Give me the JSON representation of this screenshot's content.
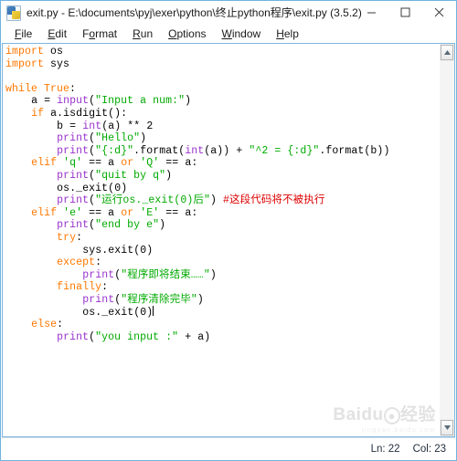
{
  "window": {
    "title": "exit.py - E:\\documents\\pyj\\exer\\python\\终止python程序\\exit.py (3.5.2)",
    "icon": "python-file-icon",
    "minimize_label": "─",
    "maximize_label": "☐",
    "close_label": "✕"
  },
  "menubar": {
    "items": [
      {
        "label": "File",
        "accel": "F",
        "rest": "ile"
      },
      {
        "label": "Edit",
        "accel": "E",
        "rest": "dit"
      },
      {
        "label": "Format",
        "accel": "o",
        "pre": "F",
        "rest": "rmat"
      },
      {
        "label": "Run",
        "accel": "R",
        "rest": "un"
      },
      {
        "label": "Options",
        "accel": "O",
        "rest": "ptions"
      },
      {
        "label": "Window",
        "accel": "W",
        "rest": "indow"
      },
      {
        "label": "Help",
        "accel": "H",
        "rest": "elp"
      }
    ]
  },
  "editor": {
    "language": "python",
    "cursor_line": 22,
    "cursor_col": 23,
    "lines": [
      "import os",
      "import sys",
      "",
      "while True:",
      "    a = input(\"Input a num:\")",
      "    if a.isdigit():",
      "        b = int(a) ** 2",
      "        print(\"Hello\")",
      "        print(\"{:d}\".format(int(a)) + \"^2 = {:d}\".format(b))",
      "    elif 'q' == a or 'Q' == a:",
      "        print(\"quit by q\")",
      "        os._exit(0)",
      "        print(\"运行os._exit(0)后\") #这段代码将不被执行",
      "    elif 'e' == a or 'E' == a:",
      "        print(\"end by e\")",
      "        try:",
      "            sys.exit(0)",
      "        except:",
      "            print(\"程序即将结束……\")",
      "        finally:",
      "            print(\"程序清除完毕\")",
      "            os._exit(0)",
      "    else:",
      "        print(\"you input :\" + a)"
    ],
    "colors": {
      "keyword": "#ff7700",
      "builtin": "#9932cc",
      "string": "#00aa00",
      "comment": "#dd0000",
      "plain": "#000000",
      "background": "#ffffff",
      "border": "#7fb6de"
    }
  },
  "scrollbar": {
    "up_arrow": "scroll-up-icon",
    "down_arrow": "scroll-down-icon"
  },
  "watermark": {
    "brand": "Baidu",
    "suffix": "经验",
    "url": "jingyan.baidu.com"
  },
  "statusbar": {
    "line_label": "Ln: 22",
    "col_label": "Col: 23"
  }
}
